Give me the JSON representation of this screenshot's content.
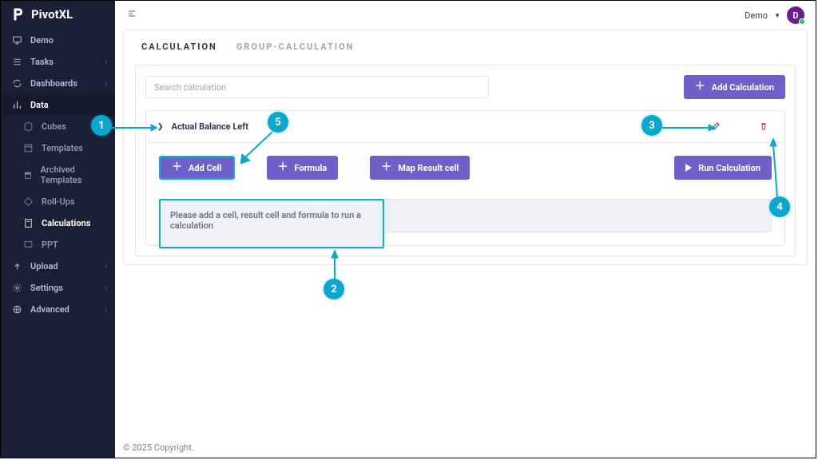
{
  "brand": {
    "name": "PivotXL"
  },
  "user": {
    "menu_label": "Demo",
    "avatar_initial": "D"
  },
  "sidebar": {
    "items": [
      {
        "label": "Demo"
      },
      {
        "label": "Tasks"
      },
      {
        "label": "Dashboards"
      },
      {
        "label": "Data"
      },
      {
        "label": "Cubes"
      },
      {
        "label": "Templates"
      },
      {
        "label": "Archived Templates"
      },
      {
        "label": "Roll-Ups"
      },
      {
        "label": "Calculations"
      },
      {
        "label": "PPT"
      },
      {
        "label": "Upload"
      },
      {
        "label": "Settings"
      },
      {
        "label": "Advanced"
      }
    ]
  },
  "tabs": {
    "calculation": "CALCULATION",
    "group_calculation": "GROUP-CALCULATION"
  },
  "search": {
    "placeholder": "Search calculation"
  },
  "buttons": {
    "add_calculation": "Add Calculation",
    "add_cell": "Add Cell",
    "formula": "Formula",
    "map_result_cell": "Map Result cell",
    "run_calculation": "Run Calculation"
  },
  "calc": {
    "title": "Actual Balance Left",
    "placeholder": "Please add a cell, result cell and formula to run a calculation"
  },
  "footer": "© 2025 Copyright.",
  "annotations": {
    "n1": "1",
    "n2": "2",
    "n3": "3",
    "n4": "4",
    "n5": "5"
  }
}
